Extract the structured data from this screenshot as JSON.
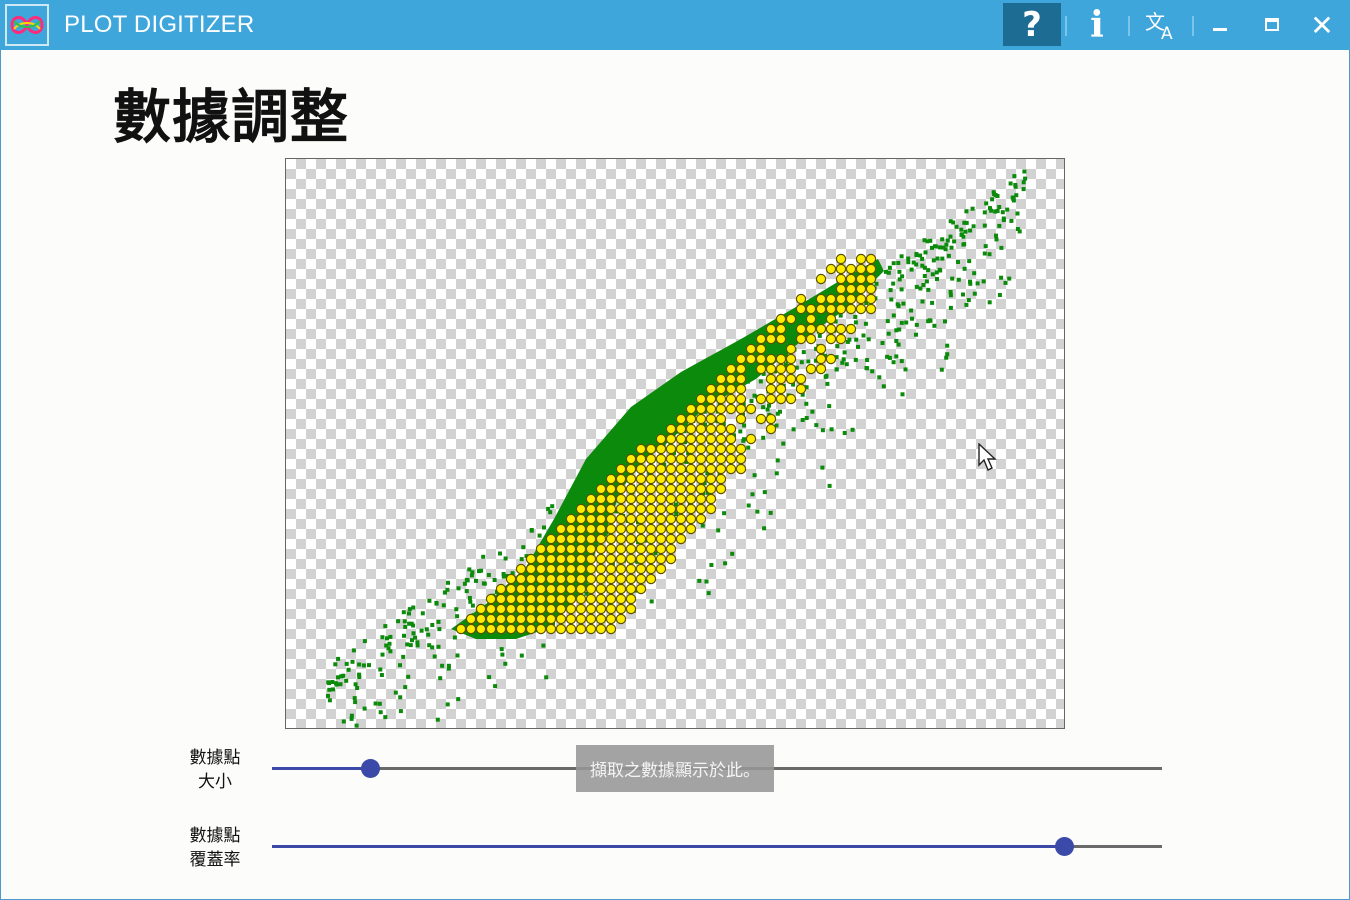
{
  "app": {
    "title": "PLOT DIGITIZER",
    "logo": "infinity-loop-logo",
    "title_bar_color": "#3fa6dc"
  },
  "toolbar": {
    "help_icon": "question-mark-icon",
    "help_label": "?",
    "info_icon": "info-icon",
    "info_label": "i",
    "translate_icon": "translate-icon",
    "minimize_icon": "minimize-icon",
    "maximize_icon": "maximize-icon",
    "close_icon": "close-icon",
    "close_label": "✕"
  },
  "page": {
    "title": "數據調整"
  },
  "plot": {
    "background": "transparent-checkerboard",
    "cluster_color": "#0b8a0b",
    "point_fill": "#ffee00",
    "point_stroke": "#5a5000"
  },
  "controls": {
    "point_size": {
      "label_line1": "數據點",
      "label_line2": "大小",
      "value": 0.11,
      "color": "#3b4aa8"
    },
    "point_coverage": {
      "label_line1": "數據點",
      "label_line2": "覆蓋率",
      "value": 0.89,
      "color": "#3b4aa8"
    }
  },
  "toast": {
    "text": "擷取之數據顯示於此。"
  }
}
